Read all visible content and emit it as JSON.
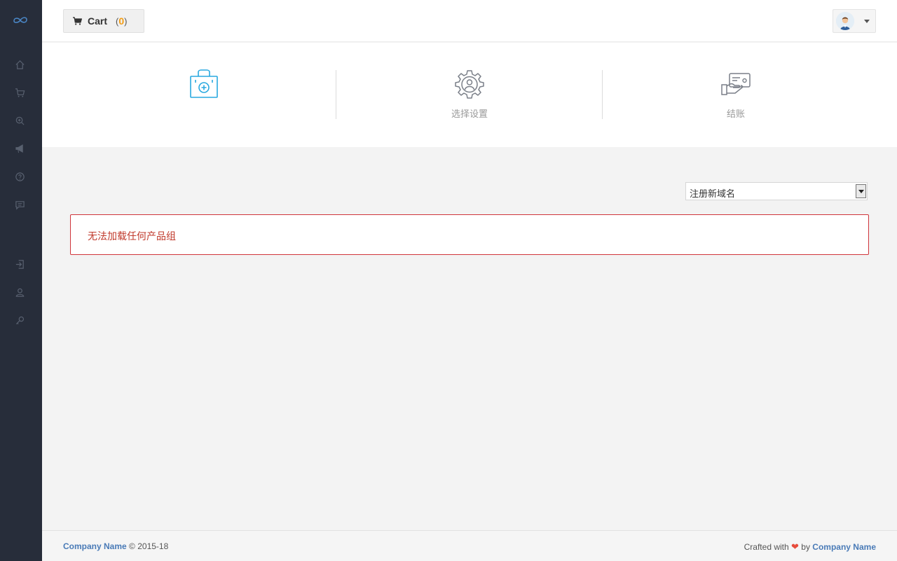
{
  "header": {
    "cart_label": "Cart",
    "cart_open_paren": "(",
    "cart_count": "0",
    "cart_close_paren": ")"
  },
  "steps": [
    {
      "label": ""
    },
    {
      "label": "选择设置"
    },
    {
      "label": "结账"
    }
  ],
  "selector": {
    "value": "注册新域名"
  },
  "alert": {
    "message": "无法加载任何产品组"
  },
  "footer": {
    "company_left": "Company Name",
    "copyright": "© 2015-18",
    "crafted_with": "Crafted with",
    "heart": "❤",
    "by": "by",
    "company_right": "Company Name"
  },
  "colors": {
    "sidebar_bg": "#272d3a",
    "active_step": "#29a9e0",
    "cart_count": "#f39c12",
    "alert_border": "#d0343a",
    "link": "#4a7bb7"
  },
  "icons": {
    "sidebar": [
      "home-icon",
      "cart-icon",
      "search-icon",
      "megaphone-icon",
      "help-icon",
      "chat-icon",
      "login-icon",
      "user-icon",
      "key-icon"
    ],
    "steps": [
      "bag-plus-icon",
      "gear-user-icon",
      "card-hand-icon"
    ]
  }
}
